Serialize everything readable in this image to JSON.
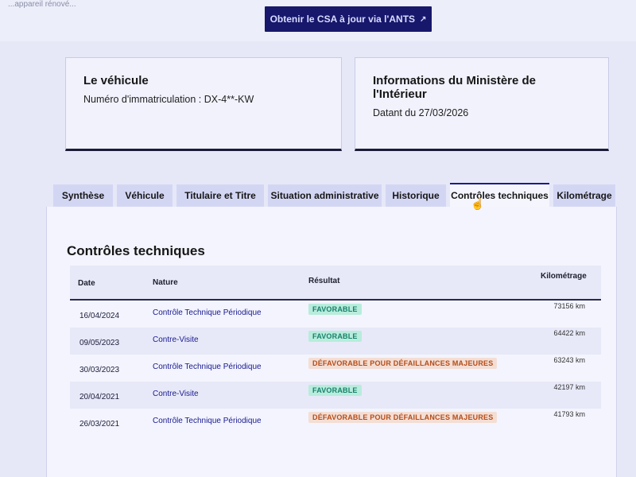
{
  "header": {
    "crumb": "...appareil rénové...",
    "ants_button_label": "Obtenir le CSA à jour via l'ANTS",
    "ants_button_icon": "external-link-icon"
  },
  "vehicle_card": {
    "title": "Le véhicule",
    "registration": "Numéro d'immatriculation : DX-4**-KW"
  },
  "ministry_card": {
    "title": "Informations du Ministère de l'Intérieur",
    "date": "Datant du 27/03/2026"
  },
  "tabs": [
    {
      "label": "Synthèse"
    },
    {
      "label": "Véhicule"
    },
    {
      "label": "Titulaire et Titre"
    },
    {
      "label": "Situation administrative"
    },
    {
      "label": "Historique"
    },
    {
      "label": "Contrôles techniques"
    },
    {
      "label": "Kilométrage"
    }
  ],
  "active_tab": "Contrôles techniques",
  "section": {
    "title": "Contrôles techniques",
    "columns": {
      "date": "Date",
      "nature": "Nature",
      "result": "Résultat",
      "mileage": "Kilométrage"
    },
    "rows": [
      {
        "date": "16/04/2024",
        "nature": "Contrôle Technique Périodique",
        "result": "FAVORABLE",
        "status": "ok",
        "mileage": "73156 km"
      },
      {
        "date": "09/05/2023",
        "nature": "Contre-Visite",
        "result": "FAVORABLE",
        "status": "ok",
        "mileage": "64422 km"
      },
      {
        "date": "30/03/2023",
        "nature": "Contrôle Technique Périodique",
        "result": "DÉFAVORABLE POUR DÉFAILLANCES MAJEURES",
        "status": "ko",
        "mileage": "63243 km"
      },
      {
        "date": "20/04/2021",
        "nature": "Contre-Visite",
        "result": "FAVORABLE",
        "status": "ok",
        "mileage": "42197 km"
      },
      {
        "date": "26/03/2021",
        "nature": "Contrôle Technique Périodique",
        "result": "DÉFAVORABLE POUR DÉFAILLANCES MAJEURES",
        "status": "ko",
        "mileage": "41793 km"
      }
    ]
  },
  "colors": {
    "primary": "#17176b",
    "favorable_bg": "#b8ecdc",
    "favorable_text": "#17806b",
    "defavorable_bg": "#f4ded4",
    "defavorable_text": "#b54d1a"
  }
}
